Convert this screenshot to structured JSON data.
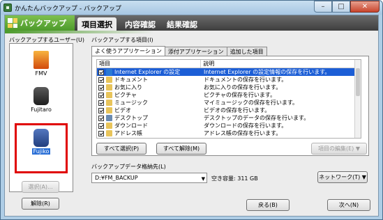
{
  "window": {
    "title": "かんたんバックアップ - バックアップ",
    "controls": {
      "minimize": "–",
      "maximize": "□",
      "close": "✕"
    }
  },
  "app_bar": {
    "brand": "バックアップ",
    "steps": [
      "項目選択",
      "内容確認",
      "結果確認"
    ],
    "active_step": 0,
    "colors": {
      "brand_green": "#4c9a2a",
      "bar_dark": "#3e3e3e",
      "selection_blue": "#1c5ed6",
      "highlight_red": "#e00000"
    }
  },
  "users_panel": {
    "label": "バックアップするユーザー(U)",
    "users": [
      {
        "name": "FMV",
        "icon": "fmv-flame-icon"
      },
      {
        "name": "Fujitaro",
        "icon": "user-photo-icon"
      },
      {
        "name": "Fujiko",
        "icon": "user-photo-icon",
        "selected": true
      }
    ],
    "select_button": "選択(A)...",
    "deselect_button": "解除(R)"
  },
  "items_panel": {
    "label": "バックアップする項目(I)",
    "tabs": [
      "よく使うアプリケーション",
      "添付アプリケーション",
      "追加した項目"
    ],
    "active_tab": 0,
    "columns": [
      "項目",
      "説明"
    ],
    "rows": [
      {
        "name": "Internet Explorer の設定",
        "desc": "Internet Explorer の設定情報の保存を行います。",
        "checked": true,
        "selected": true,
        "icon": "ie-icon"
      },
      {
        "name": "ドキュメント",
        "desc": "ドキュメントの保存を行います。",
        "checked": true,
        "icon": "folder-icon"
      },
      {
        "name": "お気に入り",
        "desc": "お気に入りの保存を行います。",
        "checked": true,
        "icon": "folder-icon"
      },
      {
        "name": "ピクチャ",
        "desc": "ピクチャの保存を行います。",
        "checked": true,
        "icon": "folder-icon"
      },
      {
        "name": "ミュージック",
        "desc": "マイミュージックの保存を行います。",
        "checked": true,
        "icon": "folder-icon"
      },
      {
        "name": "ビデオ",
        "desc": "ビデオの保存を行います。",
        "checked": true,
        "icon": "folder-icon"
      },
      {
        "name": "デスクトップ",
        "desc": "デスクトップのデータの保存を行います。",
        "checked": true,
        "icon": "desktop-icon"
      },
      {
        "name": "ダウンロード",
        "desc": "ダウンロードの保存を行います。",
        "checked": true,
        "icon": "folder-icon"
      },
      {
        "name": "アドレス帳",
        "desc": "アドレス帳の保存を行います。",
        "checked": true,
        "icon": "folder-icon"
      }
    ],
    "select_all": "すべて選択(P)",
    "deselect_all": "すべて解除(M)",
    "edit_items": "項目の編集(E) ▼"
  },
  "destination": {
    "label": "バックアップデータ格納先(L)",
    "value": "D:¥FM_BACKUP",
    "free_space": "空き容量: 311 GB",
    "network_button": "ネットワーク(T) ▼"
  },
  "footer": {
    "back": "戻る(B)",
    "next": "次へ(N)"
  }
}
